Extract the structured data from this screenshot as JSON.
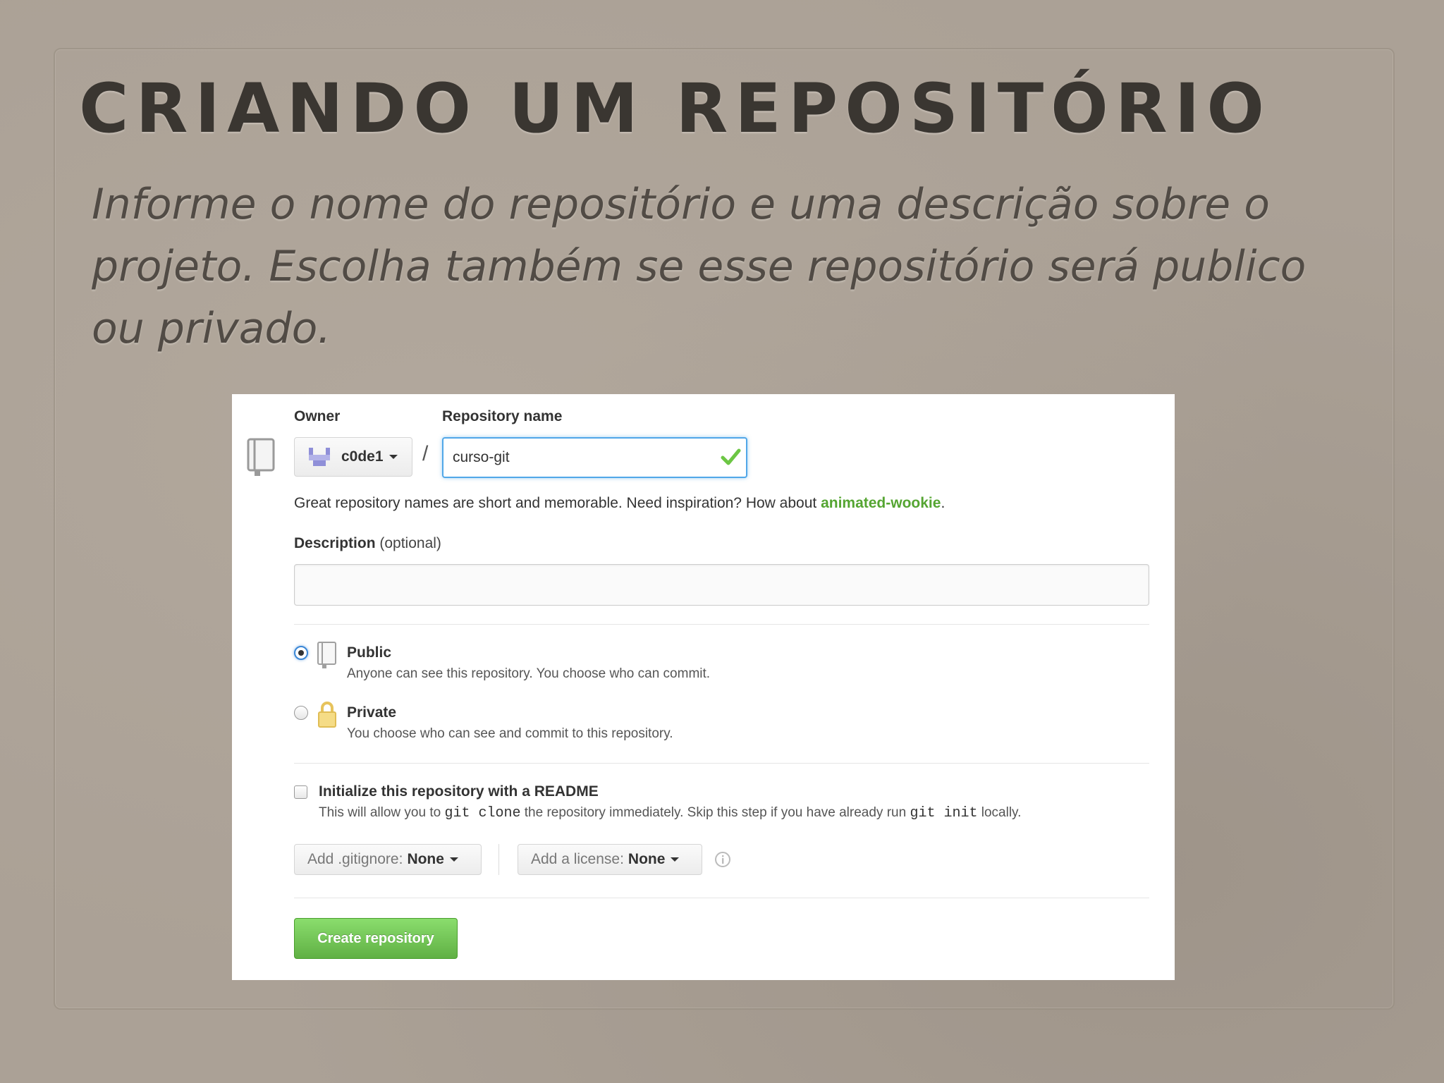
{
  "slide": {
    "title": "CRIANDO UM REPOSITÓRIO",
    "body": "Informe o nome do repositório e uma descrição sobre o projeto. Escolha também se esse repositório será publico ou privado."
  },
  "form": {
    "owner_label": "Owner",
    "owner_value": "c0de1",
    "separator": "/",
    "repo_name_label": "Repository name",
    "repo_name_value": "curso-git",
    "hint_text": "Great repository names are short and memorable. Need inspiration? How about ",
    "hint_suggestion": "animated-wookie",
    "hint_end": ".",
    "description_label": "Description",
    "description_optional": "(optional)",
    "description_value": "",
    "visibility": [
      {
        "title": "Public",
        "desc": "Anyone can see this repository. You choose who can commit.",
        "checked": true
      },
      {
        "title": "Private",
        "desc": "You choose who can see and commit to this repository.",
        "checked": false
      }
    ],
    "readme": {
      "label": "Initialize this repository with a README",
      "desc_1": "This will allow you to ",
      "code_1": "git clone",
      "desc_2": " the repository immediately. Skip this step if you have already run ",
      "code_2": "git init",
      "desc_3": " locally.",
      "checked": false
    },
    "gitignore": {
      "label": "Add .gitignore:",
      "value": "None"
    },
    "license": {
      "label": "Add a license:",
      "value": "None"
    },
    "create_button": "Create repository"
  },
  "colors": {
    "accent_blue": "#51a7e8",
    "success_green": "#55a532",
    "button_green": "#60b044"
  },
  "icons": {
    "repo": "repo-book-icon",
    "owner": "organization-avatar-icon",
    "valid": "checkmark-icon",
    "public": "public-repo-icon",
    "private": "lock-icon",
    "info": "info-icon"
  }
}
